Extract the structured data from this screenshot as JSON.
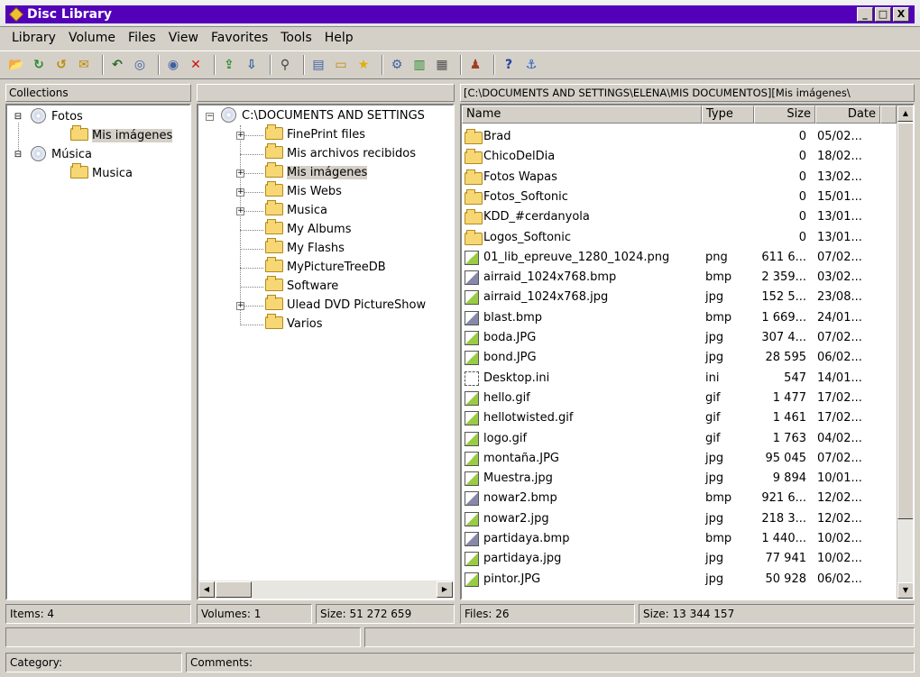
{
  "window": {
    "title": "Disc Library",
    "min": "_",
    "max": "□",
    "close": "X"
  },
  "menu": [
    "Library",
    "Volume",
    "Files",
    "View",
    "Favorites",
    "Tools",
    "Help"
  ],
  "toolbar_icons": [
    {
      "name": "open-library-icon",
      "glyph": "📂",
      "color": "#c08a00"
    },
    {
      "name": "add-volume-icon",
      "glyph": "↻",
      "color": "#2a8a2a"
    },
    {
      "name": "refresh-volume-icon",
      "glyph": "↺",
      "color": "#c08a00"
    },
    {
      "name": "edit-volume-icon",
      "glyph": "✉",
      "color": "#c08a00"
    },
    {
      "sep": true
    },
    {
      "name": "undo-icon",
      "glyph": "↶",
      "color": "#2a6a2a"
    },
    {
      "name": "disc-icon",
      "glyph": "◎",
      "color": "#4060a0"
    },
    {
      "sep": true
    },
    {
      "name": "scan-disc-icon",
      "glyph": "◉",
      "color": "#4060a0"
    },
    {
      "name": "delete-icon",
      "glyph": "✕",
      "color": "#d01010"
    },
    {
      "sep": true
    },
    {
      "name": "export-icon",
      "glyph": "⇪",
      "color": "#2a8a2a"
    },
    {
      "name": "import-icon",
      "glyph": "⇩",
      "color": "#2a5a9a"
    },
    {
      "sep": true
    },
    {
      "name": "search-icon",
      "glyph": "⚲",
      "color": "#404040"
    },
    {
      "sep": true
    },
    {
      "name": "properties-icon",
      "glyph": "▤",
      "color": "#4060a0"
    },
    {
      "name": "new-folder-icon",
      "glyph": "▭",
      "color": "#c08a00"
    },
    {
      "name": "favorites-icon",
      "glyph": "★",
      "color": "#e0b000"
    },
    {
      "sep": true
    },
    {
      "name": "options-icon",
      "glyph": "⚙",
      "color": "#4060a0"
    },
    {
      "name": "filter-icon",
      "glyph": "▥",
      "color": "#2a8a2a"
    },
    {
      "name": "report-icon",
      "glyph": "▦",
      "color": "#505050"
    },
    {
      "sep": true
    },
    {
      "name": "users-icon",
      "glyph": "♟",
      "color": "#a04020"
    },
    {
      "sep": true
    },
    {
      "name": "help-icon",
      "glyph": "?",
      "color": "#2040a0"
    },
    {
      "name": "web-icon",
      "glyph": "⚓",
      "color": "#2060c0"
    }
  ],
  "collections": {
    "header": "Collections",
    "items": [
      {
        "label": "Fotos",
        "level": 0,
        "expander": "⊟"
      },
      {
        "label": "Mis imágenes",
        "level": 1,
        "selected": true
      },
      {
        "label": "Música",
        "level": 0,
        "expander": "⊟"
      },
      {
        "label": "Musica",
        "level": 1
      }
    ]
  },
  "folders": {
    "root": "C:\\DOCUMENTS AND SETTINGS",
    "items": [
      {
        "label": "FinePrint files",
        "expander": "+"
      },
      {
        "label": "Mis archivos recibidos",
        "expander": ""
      },
      {
        "label": "Mis imágenes",
        "expander": "+",
        "selected": true
      },
      {
        "label": "Mis Webs",
        "expander": "+"
      },
      {
        "label": "Musica",
        "expander": "+"
      },
      {
        "label": "My Albums",
        "expander": ""
      },
      {
        "label": "My Flashs",
        "expander": ""
      },
      {
        "label": "MyPictureTreeDB",
        "expander": ""
      },
      {
        "label": "Software",
        "expander": ""
      },
      {
        "label": "Ulead DVD PictureShow",
        "expander": "+"
      },
      {
        "label": "Varios",
        "expander": ""
      }
    ]
  },
  "files": {
    "path": "[C:\\DOCUMENTS AND SETTINGS\\ELENA\\MIS DOCUMENTOS][Mis imágenes\\",
    "columns": [
      "Name",
      "Type",
      "Size",
      "Date"
    ],
    "rows": [
      {
        "name": "Brad",
        "type": "",
        "size": "0",
        "date": "05/02...",
        "kind": "folder"
      },
      {
        "name": "ChicoDelDia",
        "type": "",
        "size": "0",
        "date": "18/02...",
        "kind": "folder"
      },
      {
        "name": "Fotos Wapas",
        "type": "",
        "size": "0",
        "date": "13/02...",
        "kind": "folder"
      },
      {
        "name": "Fotos_Softonic",
        "type": "",
        "size": "0",
        "date": "15/01...",
        "kind": "folder"
      },
      {
        "name": "KDD_#cerdanyola",
        "type": "",
        "size": "0",
        "date": "13/01...",
        "kind": "folder"
      },
      {
        "name": "Logos_Softonic",
        "type": "",
        "size": "0",
        "date": "13/01...",
        "kind": "folder"
      },
      {
        "name": "01_lib_epreuve_1280_1024.png",
        "type": "png",
        "size": "611 6...",
        "date": "07/02...",
        "kind": "img"
      },
      {
        "name": "airraid_1024x768.bmp",
        "type": "bmp",
        "size": "2 359...",
        "date": "03/02...",
        "kind": "bmp"
      },
      {
        "name": "airraid_1024x768.jpg",
        "type": "jpg",
        "size": "152 5...",
        "date": "23/08...",
        "kind": "img"
      },
      {
        "name": "blast.bmp",
        "type": "bmp",
        "size": "1 669...",
        "date": "24/01...",
        "kind": "bmp"
      },
      {
        "name": "boda.JPG",
        "type": "jpg",
        "size": "307 4...",
        "date": "07/02...",
        "kind": "img"
      },
      {
        "name": "bond.JPG",
        "type": "jpg",
        "size": "28 595",
        "date": "06/02...",
        "kind": "img"
      },
      {
        "name": "Desktop.ini",
        "type": "ini",
        "size": "547",
        "date": "14/01...",
        "kind": "doc"
      },
      {
        "name": "hello.gif",
        "type": "gif",
        "size": "1 477",
        "date": "17/02...",
        "kind": "img"
      },
      {
        "name": "hellotwisted.gif",
        "type": "gif",
        "size": "1 461",
        "date": "17/02...",
        "kind": "img"
      },
      {
        "name": "logo.gif",
        "type": "gif",
        "size": "1 763",
        "date": "04/02...",
        "kind": "img"
      },
      {
        "name": "montaña.JPG",
        "type": "jpg",
        "size": "95 045",
        "date": "07/02...",
        "kind": "img"
      },
      {
        "name": "Muestra.jpg",
        "type": "jpg",
        "size": "9 894",
        "date": "10/01...",
        "kind": "img"
      },
      {
        "name": "nowar2.bmp",
        "type": "bmp",
        "size": "921 6...",
        "date": "12/02...",
        "kind": "bmp"
      },
      {
        "name": "nowar2.jpg",
        "type": "jpg",
        "size": "218 3...",
        "date": "12/02...",
        "kind": "img"
      },
      {
        "name": "partidaya.bmp",
        "type": "bmp",
        "size": "1 440...",
        "date": "10/02...",
        "kind": "bmp"
      },
      {
        "name": "partidaya.jpg",
        "type": "jpg",
        "size": "77 941",
        "date": "10/02...",
        "kind": "img"
      },
      {
        "name": "pintor.JPG",
        "type": "jpg",
        "size": "50 928",
        "date": "06/02...",
        "kind": "img"
      }
    ]
  },
  "status": {
    "items": "Items: 4",
    "volumes": "Volumes: 1",
    "vol_size": "Size: 51 272 659",
    "files": "Files: 26",
    "files_size": "Size: 13 344 157",
    "category": "Category:",
    "comments": "Comments:"
  }
}
